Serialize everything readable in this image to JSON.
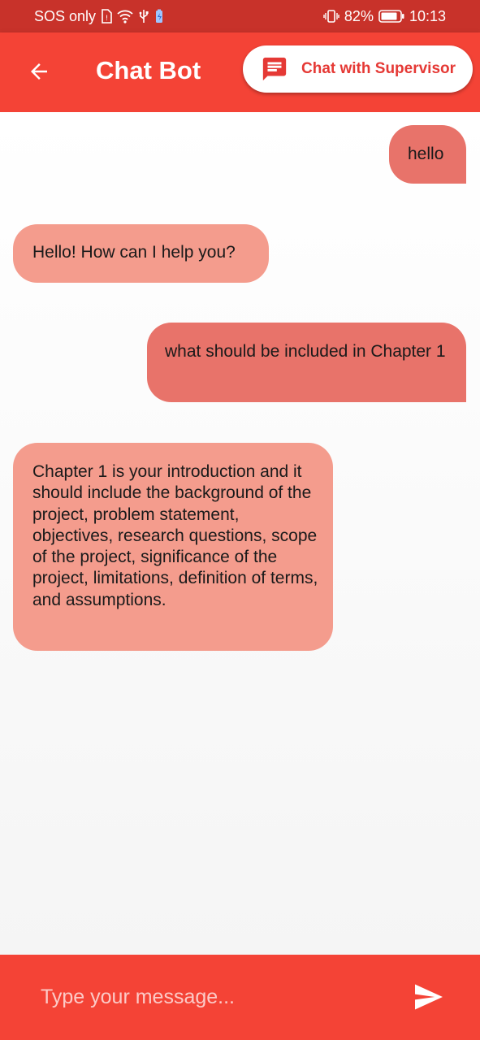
{
  "status_bar": {
    "carrier": "SOS only",
    "battery_percent": "82%",
    "time": "10:13",
    "icons": [
      "sim-icon",
      "wifi-icon",
      "usb-icon",
      "battery-saver-icon",
      "vibrate-icon",
      "battery-icon"
    ]
  },
  "app_bar": {
    "title": "Chat Bot",
    "supervisor_button_label": "Chat with Supervisor",
    "back_icon": "arrow-back-icon",
    "chat_icon": "chat-bubble-icon"
  },
  "messages": [
    {
      "sender": "user",
      "text": "hello"
    },
    {
      "sender": "bot",
      "text": "Hello! How can I help you?"
    },
    {
      "sender": "user",
      "text": "what should be included in Chapter 1"
    },
    {
      "sender": "bot",
      "text": "Chapter 1 is your introduction and it should include the background of the project, problem statement, objectives, research questions, scope of the project, significance of the project, limitations, definition of terms, and assumptions."
    }
  ],
  "input": {
    "value": "",
    "placeholder": "Type your message...",
    "send_icon": "send-icon"
  },
  "colors": {
    "primary": "#f44336",
    "status_bar": "#c8322a",
    "user_bubble": "#e8736a",
    "bot_bubble": "#f49c8d",
    "supervisor_accent": "#e53935"
  }
}
